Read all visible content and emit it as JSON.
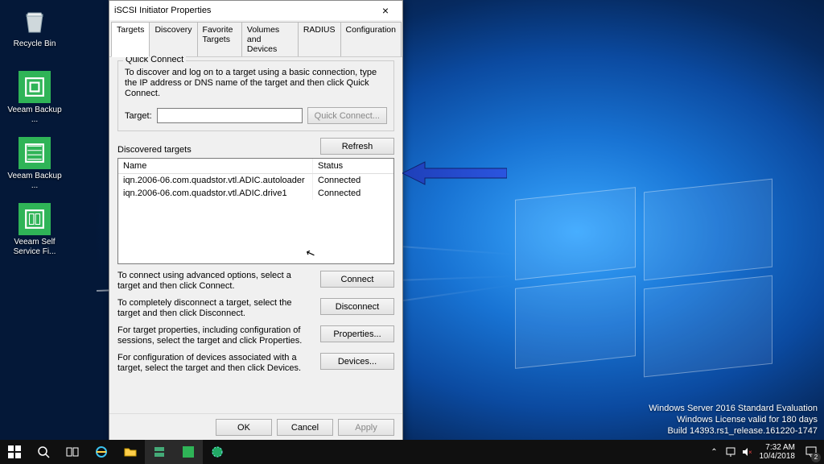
{
  "desktop": {
    "icons": [
      {
        "name": "recycle-bin",
        "label": "Recycle Bin"
      },
      {
        "name": "veeam-backup",
        "label": "Veeam Backup ..."
      },
      {
        "name": "veeam-backup2",
        "label": "Veeam Backup ..."
      },
      {
        "name": "veeam-self-service",
        "label": "Veeam Self Service Fi..."
      }
    ],
    "watermark": {
      "line1": "Windows Server 2016 Standard Evaluation",
      "line2": "Windows License valid for 180 days",
      "line3": "Build 14393.rs1_release.161220-1747"
    }
  },
  "dialog": {
    "title": "iSCSI Initiator Properties",
    "tabs": [
      "Targets",
      "Discovery",
      "Favorite Targets",
      "Volumes and Devices",
      "RADIUS",
      "Configuration"
    ],
    "active_tab": 0,
    "quick_connect": {
      "group_title": "Quick Connect",
      "help": "To discover and log on to a target using a basic connection, type the IP address or DNS name of the target and then click Quick Connect.",
      "target_label": "Target:",
      "target_value": "",
      "button": "Quick Connect..."
    },
    "discovered": {
      "label": "Discovered targets",
      "refresh": "Refresh",
      "col_name": "Name",
      "col_status": "Status",
      "rows": [
        {
          "name": "iqn.2006-06.com.quadstor.vtl.ADIC.autoloader",
          "status": "Connected"
        },
        {
          "name": "iqn.2006-06.com.quadstor.vtl.ADIC.drive1",
          "status": "Connected"
        }
      ]
    },
    "actions": [
      {
        "help": "To connect using advanced options, select a target and then click Connect.",
        "button": "Connect"
      },
      {
        "help": "To completely disconnect a target, select the target and then click Disconnect.",
        "button": "Disconnect"
      },
      {
        "help": "For target properties, including configuration of sessions, select the target and click Properties.",
        "button": "Properties..."
      },
      {
        "help": "For configuration of devices associated with a target, select the target and then click Devices.",
        "button": "Devices..."
      }
    ],
    "buttons": {
      "ok": "OK",
      "cancel": "Cancel",
      "apply": "Apply"
    }
  },
  "taskbar": {
    "time": "7:32 AM",
    "date": "10/4/2018",
    "notif_count": "2"
  }
}
